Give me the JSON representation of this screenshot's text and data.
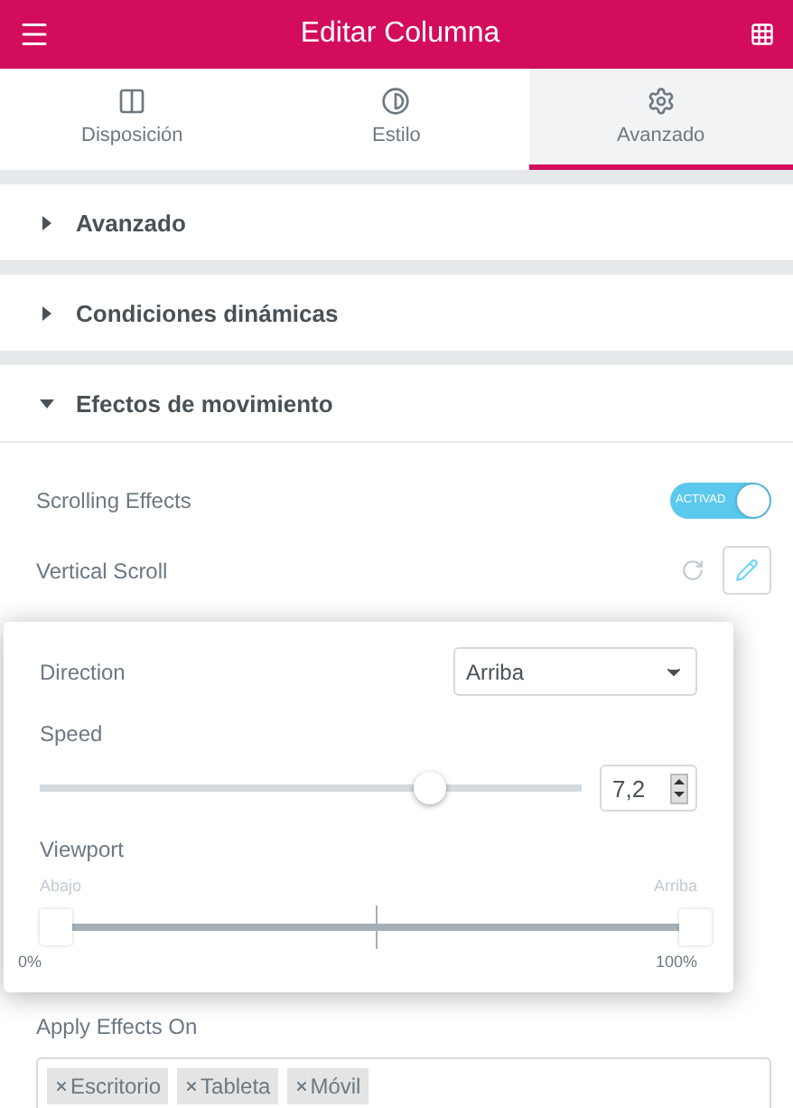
{
  "header": {
    "title": "Editar Columna"
  },
  "tabs": [
    {
      "label": "Disposición",
      "selected": false
    },
    {
      "label": "Estilo",
      "selected": false
    },
    {
      "label": "Avanzado",
      "selected": true
    }
  ],
  "sections": [
    {
      "title": "Avanzado",
      "expanded": false
    },
    {
      "title": "Condiciones dinámicas",
      "expanded": false
    },
    {
      "title": "Efectos de movimiento",
      "expanded": true
    }
  ],
  "scrolling_effects": {
    "label": "Scrolling Effects",
    "on": true,
    "state_text": "ACTIVAD"
  },
  "vertical_scroll": {
    "label": "Vertical Scroll"
  },
  "popup": {
    "direction": {
      "label": "Direction",
      "value": "Arriba"
    },
    "speed": {
      "label": "Speed",
      "level": 0.72,
      "value": "7,2"
    },
    "viewport": {
      "label": "Viewport",
      "start_hint": "Abajo",
      "end_hint": "Arriba",
      "start": {
        "level": 0,
        "reading": "0%"
      },
      "end": {
        "level": 1,
        "reading": "100%"
      }
    }
  },
  "apply_effects": {
    "label": "Apply Effects On",
    "tags": [
      "Escritorio",
      "Tableta",
      "Móvil"
    ]
  }
}
